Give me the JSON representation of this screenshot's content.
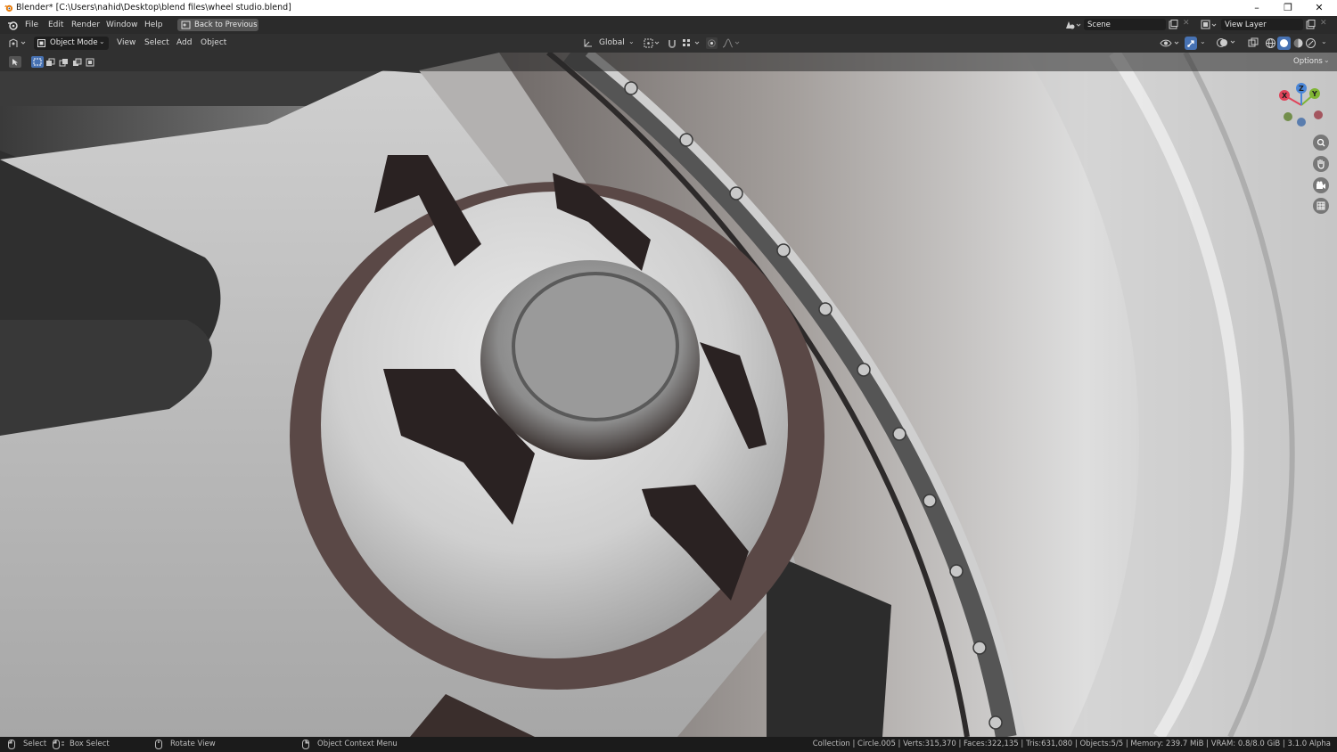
{
  "window": {
    "title": "Blender* [C:\\Users\\nahid\\Desktop\\blend files\\wheel studio.blend]",
    "controls": {
      "minimize": "–",
      "restore": "❐",
      "close": "✕"
    }
  },
  "topbar": {
    "menus": [
      "File",
      "Edit",
      "Render",
      "Window",
      "Help"
    ],
    "back_button": "Back to Previous",
    "scene": "Scene",
    "view_layer": "View Layer"
  },
  "header": {
    "mode": "Object Mode",
    "menus": [
      "View",
      "Select",
      "Add",
      "Object"
    ],
    "orientation": "Global"
  },
  "viewport": {
    "options_label": "Options",
    "gizmo_axes": [
      "X",
      "Y",
      "Z"
    ]
  },
  "statusbar": {
    "select": "Select",
    "box_select": "Box Select",
    "rotate_view": "Rotate View",
    "context_menu": "Object Context Menu",
    "stats": "Collection | Circle.005 | Verts:315,370 | Faces:322,135 | Tris:631,080 | Objects:5/5 | Memory: 239.7 MiB | VRAM: 0.8/8.0 GiB | 3.1.0 Alpha"
  },
  "colors": {
    "accent": "#4772b3",
    "header_bg": "#303030",
    "topbar_bg": "#2b2b2b",
    "status_bg": "#1b1b1b"
  }
}
